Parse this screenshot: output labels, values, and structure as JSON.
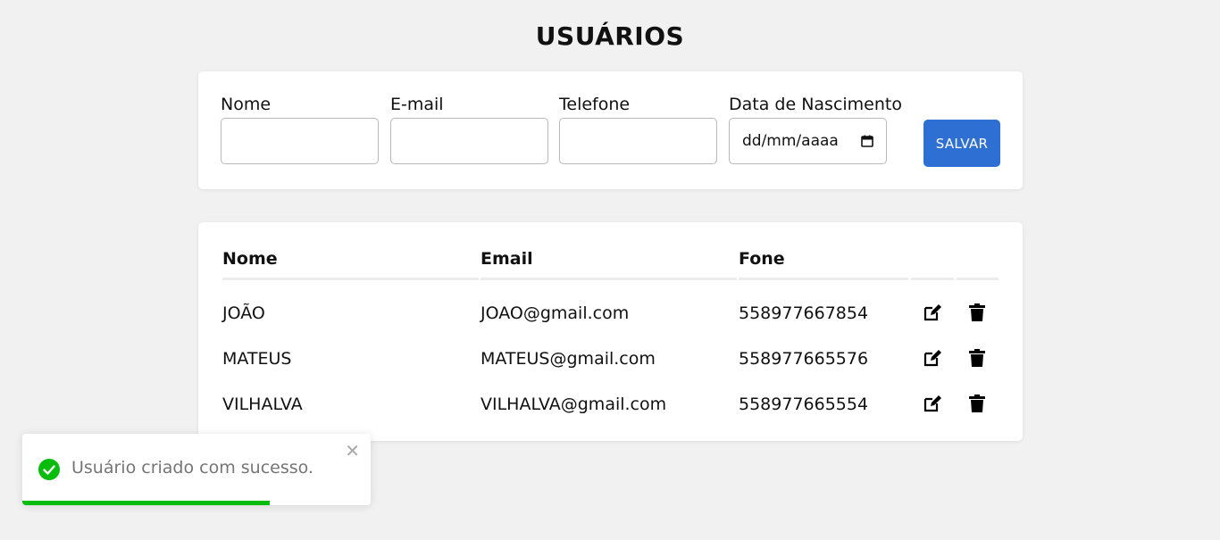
{
  "page": {
    "title": "USUÁRIOS"
  },
  "form": {
    "fields": [
      {
        "label": "Nome",
        "value": "",
        "placeholder": ""
      },
      {
        "label": "E-mail",
        "value": "",
        "placeholder": ""
      },
      {
        "label": "Telefone",
        "value": "",
        "placeholder": ""
      },
      {
        "label": "Data de Nascimento",
        "value": "dd/mm/aaaa",
        "placeholder": "dd/mm/aaaa"
      }
    ],
    "save_label": "SALVAR",
    "save_color": "#2d6fd2"
  },
  "table": {
    "headers": [
      "Nome",
      "Email",
      "Fone"
    ],
    "rows": [
      {
        "nome": "JOÃO",
        "email": "JOAO@gmail.com",
        "fone": "558977667854"
      },
      {
        "nome": "MATEUS",
        "email": "MATEUS@gmail.com",
        "fone": "558977665576"
      },
      {
        "nome": "VILHALVA",
        "email": "VILHALVA@gmail.com",
        "fone": "558977665554"
      }
    ],
    "row_actions": [
      "edit-icon",
      "trash-icon"
    ]
  },
  "toast": {
    "message": "Usuário criado com sucesso.",
    "icon": "check-circle-icon",
    "close_icon": "close-icon",
    "close_glyph": "✕",
    "progress": 0.71,
    "success_color": "#07bc0c"
  }
}
